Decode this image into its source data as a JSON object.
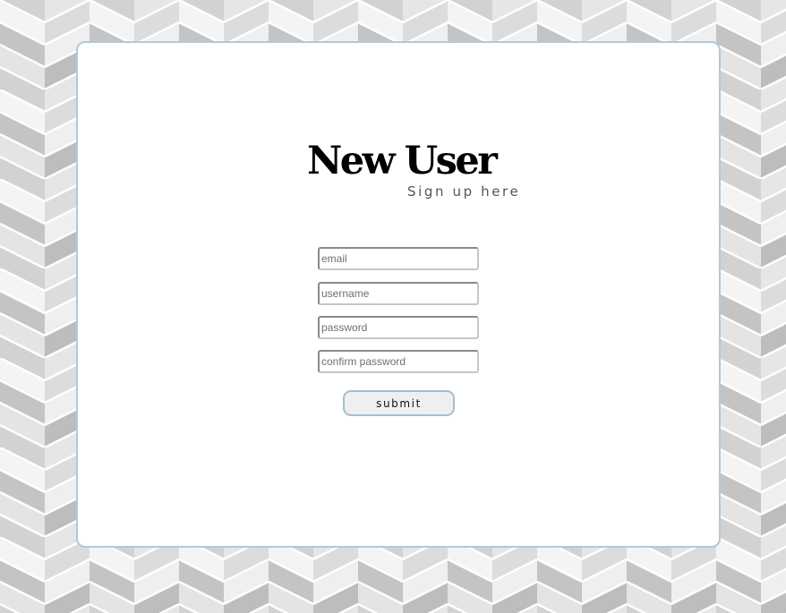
{
  "page": {
    "colors": {
      "pattern_light": "#f3f3f3",
      "pattern_mid": "#dcdcdc",
      "pattern_dark": "#bfbfbf",
      "card_border": "#b4c8d6",
      "button_border": "#a4bdd0"
    }
  },
  "form": {
    "title": "New User",
    "subtitle": "Sign up here",
    "fields": [
      {
        "placeholder": "email",
        "value": ""
      },
      {
        "placeholder": "username",
        "value": ""
      },
      {
        "placeholder": "password",
        "value": ""
      },
      {
        "placeholder": "confirm password",
        "value": ""
      }
    ],
    "submit_label": "submit"
  }
}
